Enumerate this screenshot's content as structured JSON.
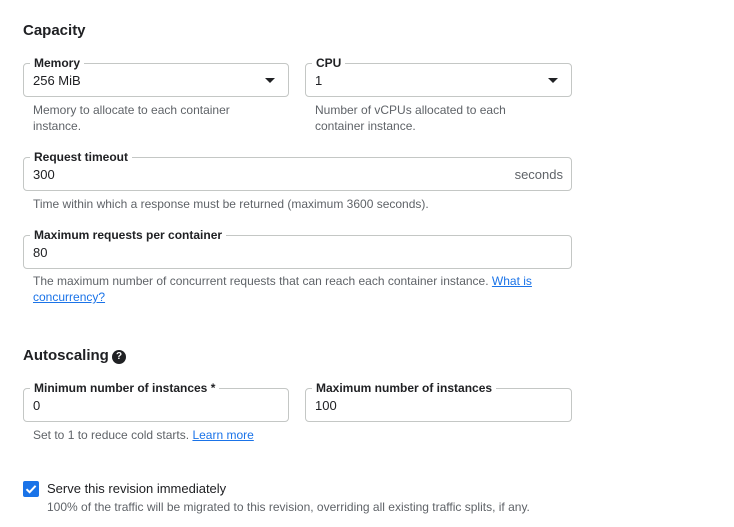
{
  "capacity": {
    "title": "Capacity",
    "memory": {
      "label": "Memory",
      "value": "256 MiB",
      "hint": "Memory to allocate to each container instance."
    },
    "cpu": {
      "label": "CPU",
      "value": "1",
      "hint": "Number of vCPUs allocated to each container instance."
    },
    "request_timeout": {
      "label": "Request timeout",
      "value": "300",
      "suffix": "seconds",
      "hint": "Time within which a response must be returned (maximum 3600 seconds)."
    },
    "max_requests": {
      "label": "Maximum requests per container",
      "value": "80",
      "hint": "The maximum number of concurrent requests that can reach each container instance.",
      "link": "What is concurrency?"
    }
  },
  "autoscaling": {
    "title": "Autoscaling",
    "help_icon": "question-circle-icon",
    "min_instances": {
      "label": "Minimum number of instances *",
      "value": "0",
      "hint": "Set to 1 to reduce cold starts.",
      "link": "Learn more"
    },
    "max_instances": {
      "label": "Maximum number of instances",
      "value": "100"
    }
  },
  "serve_revision": {
    "checked": true,
    "label": "Serve this revision immediately",
    "hint": "100% of the traffic will be migrated to this revision, overriding all existing traffic splits, if any."
  },
  "colors": {
    "accent": "#1a73e8",
    "text": "#202124",
    "secondary_text": "#5f6368",
    "border": "#c4c7c5"
  }
}
